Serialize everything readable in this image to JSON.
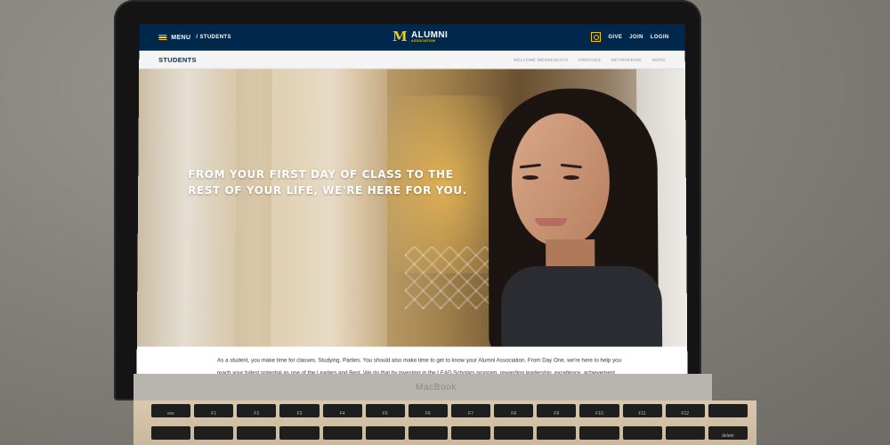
{
  "topbar": {
    "menu_label": "MENU",
    "breadcrumb": "/ STUDENTS",
    "logo_m": "M",
    "logo_title": "ALUMNI",
    "logo_sub": "ASSOCIATION",
    "links": [
      "GIVE",
      "JOIN",
      "LOGIN"
    ]
  },
  "subnav": {
    "title": "STUDENTS",
    "links": [
      "WELCOME WEDNESDAYS",
      "FRESHIES",
      "NETWORKING",
      "WORK"
    ]
  },
  "hero": {
    "headline_line1": "FROM YOUR FIRST DAY OF CLASS TO THE",
    "headline_line2": "REST OF YOUR LIFE, WE'RE HERE FOR YOU."
  },
  "body": {
    "line1": "As a student, you make time for classes. Studying. Parties. You should also make time to get to know your Alumni Association. From Day One, we're here to help you",
    "line2": "reach your fullest potential as one of the Leaders and Best. We do that by investing in the LEAD Scholars program, rewarding leadership, excellence, achievement"
  },
  "device": {
    "brand": "MacBook",
    "keys": [
      "esc",
      "F1",
      "F2",
      "F3",
      "F4",
      "F5",
      "F6",
      "F7",
      "F8",
      "F9",
      "F10",
      "F11",
      "F12",
      "",
      "",
      "",
      "",
      "",
      "",
      "",
      "",
      "",
      "",
      "",
      "",
      "",
      "",
      "delete"
    ]
  },
  "colors": {
    "primary_navy": "#00274c",
    "maize": "#ffcb05"
  }
}
